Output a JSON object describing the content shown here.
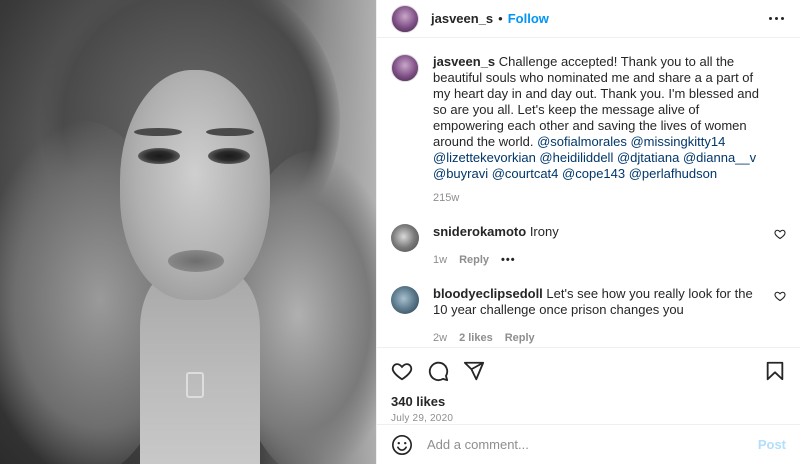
{
  "post": {
    "username": "jasveen_s",
    "follow_label": "Follow",
    "caption": {
      "username": "jasveen_s",
      "text": "Challenge accepted! Thank you to all the beautiful souls who nominated me and share a a part of my heart day in and day out. Thank you. I'm blessed and so are you all. Let's keep the message alive of empowering each other and saving the lives of women around the world.",
      "mentions": [
        "@sofialmorales",
        "@missingkitty14",
        "@lizettekevorkian",
        "@heidiliddell",
        "@djtatiana",
        "@dianna__v",
        "@buyravi",
        "@courtcat4",
        "@cope143",
        "@perlafhudson"
      ],
      "time": "215w"
    },
    "comments": [
      {
        "username": "sniderokamoto",
        "text": "Irony",
        "time": "1w",
        "likes": "",
        "reply_label": "Reply"
      },
      {
        "username": "bloodyeclipsedoll",
        "text": "Let's see how you really look for the 10 year challenge once prison changes you",
        "time": "2w",
        "likes": "2 likes",
        "reply_label": "Reply"
      }
    ],
    "likes": "340 likes",
    "date": "July 29, 2020",
    "add_comment_placeholder": "Add a comment...",
    "post_label": "Post",
    "icons": {
      "like": "heart-icon",
      "comment": "comment-icon",
      "share": "share-icon",
      "save": "bookmark-icon",
      "emoji": "emoji-icon",
      "more": "more-options-icon"
    },
    "colors": {
      "accent": "#0095f6",
      "text": "#262626",
      "muted": "#8e8e8e",
      "post_disabled": "#b2dffc"
    }
  }
}
